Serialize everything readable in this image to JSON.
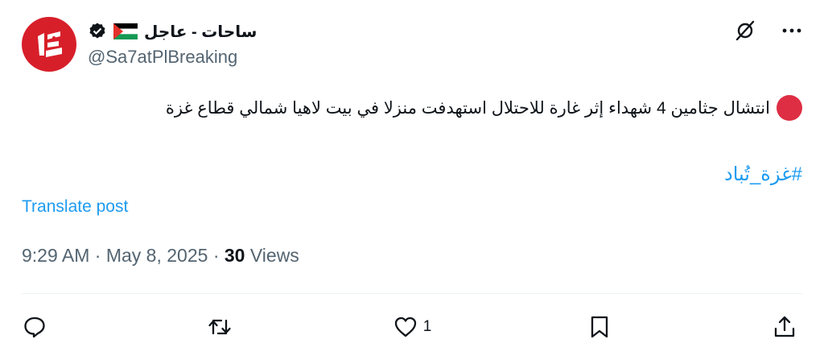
{
  "author": {
    "display_name": "ساحات - عاجل",
    "handle": "@Sa7atPlBreaking",
    "avatar_icon": "logo-icon",
    "verified_icon": "verified-badge-icon",
    "flag_icon": "palestine-flag-icon"
  },
  "header_icons": [
    "grok-icon",
    "more-icon"
  ],
  "post": {
    "text": "انتشال جثامين 4 شهداء إثر غارة للاحتلال استهدفت منزلا في بيت لاهيا شمالي قطاع غزة",
    "bullet_icon": "red-circle-icon",
    "hashtag": "#غزة_تُباد"
  },
  "translate_label": "Translate post",
  "meta": {
    "time": "9:29 AM",
    "separator": "·",
    "date": "May 8, 2025",
    "views_count": "30",
    "views_label": "Views"
  },
  "actions": {
    "reply": {
      "icon": "reply-icon",
      "count": ""
    },
    "repost": {
      "icon": "repost-icon",
      "count": ""
    },
    "like": {
      "icon": "heart-icon",
      "count": "1"
    },
    "bookmark": {
      "icon": "bookmark-icon",
      "count": ""
    },
    "share": {
      "icon": "share-icon",
      "count": ""
    }
  },
  "colors": {
    "accent": "#1d9bf0",
    "avatar_red": "#d71f2a",
    "text_primary": "#0f1419",
    "text_secondary": "#536471"
  }
}
